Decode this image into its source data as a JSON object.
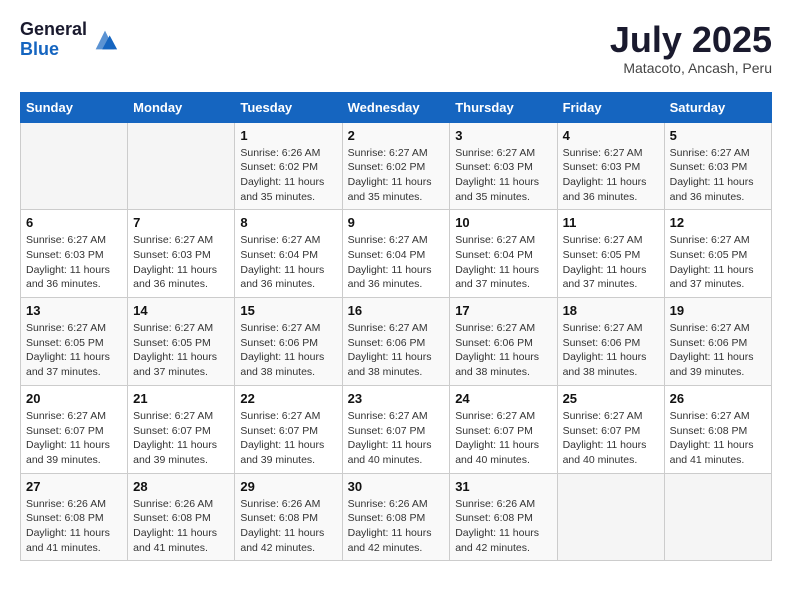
{
  "header": {
    "logo_general": "General",
    "logo_blue": "Blue",
    "month_title": "July 2025",
    "location": "Matacoto, Ancash, Peru"
  },
  "days_of_week": [
    "Sunday",
    "Monday",
    "Tuesday",
    "Wednesday",
    "Thursday",
    "Friday",
    "Saturday"
  ],
  "weeks": [
    [
      {
        "day": "",
        "sunrise": "",
        "sunset": "",
        "daylight": ""
      },
      {
        "day": "",
        "sunrise": "",
        "sunset": "",
        "daylight": ""
      },
      {
        "day": "1",
        "sunrise": "Sunrise: 6:26 AM",
        "sunset": "Sunset: 6:02 PM",
        "daylight": "Daylight: 11 hours and 35 minutes."
      },
      {
        "day": "2",
        "sunrise": "Sunrise: 6:27 AM",
        "sunset": "Sunset: 6:02 PM",
        "daylight": "Daylight: 11 hours and 35 minutes."
      },
      {
        "day": "3",
        "sunrise": "Sunrise: 6:27 AM",
        "sunset": "Sunset: 6:03 PM",
        "daylight": "Daylight: 11 hours and 35 minutes."
      },
      {
        "day": "4",
        "sunrise": "Sunrise: 6:27 AM",
        "sunset": "Sunset: 6:03 PM",
        "daylight": "Daylight: 11 hours and 36 minutes."
      },
      {
        "day": "5",
        "sunrise": "Sunrise: 6:27 AM",
        "sunset": "Sunset: 6:03 PM",
        "daylight": "Daylight: 11 hours and 36 minutes."
      }
    ],
    [
      {
        "day": "6",
        "sunrise": "Sunrise: 6:27 AM",
        "sunset": "Sunset: 6:03 PM",
        "daylight": "Daylight: 11 hours and 36 minutes."
      },
      {
        "day": "7",
        "sunrise": "Sunrise: 6:27 AM",
        "sunset": "Sunset: 6:03 PM",
        "daylight": "Daylight: 11 hours and 36 minutes."
      },
      {
        "day": "8",
        "sunrise": "Sunrise: 6:27 AM",
        "sunset": "Sunset: 6:04 PM",
        "daylight": "Daylight: 11 hours and 36 minutes."
      },
      {
        "day": "9",
        "sunrise": "Sunrise: 6:27 AM",
        "sunset": "Sunset: 6:04 PM",
        "daylight": "Daylight: 11 hours and 36 minutes."
      },
      {
        "day": "10",
        "sunrise": "Sunrise: 6:27 AM",
        "sunset": "Sunset: 6:04 PM",
        "daylight": "Daylight: 11 hours and 37 minutes."
      },
      {
        "day": "11",
        "sunrise": "Sunrise: 6:27 AM",
        "sunset": "Sunset: 6:05 PM",
        "daylight": "Daylight: 11 hours and 37 minutes."
      },
      {
        "day": "12",
        "sunrise": "Sunrise: 6:27 AM",
        "sunset": "Sunset: 6:05 PM",
        "daylight": "Daylight: 11 hours and 37 minutes."
      }
    ],
    [
      {
        "day": "13",
        "sunrise": "Sunrise: 6:27 AM",
        "sunset": "Sunset: 6:05 PM",
        "daylight": "Daylight: 11 hours and 37 minutes."
      },
      {
        "day": "14",
        "sunrise": "Sunrise: 6:27 AM",
        "sunset": "Sunset: 6:05 PM",
        "daylight": "Daylight: 11 hours and 37 minutes."
      },
      {
        "day": "15",
        "sunrise": "Sunrise: 6:27 AM",
        "sunset": "Sunset: 6:06 PM",
        "daylight": "Daylight: 11 hours and 38 minutes."
      },
      {
        "day": "16",
        "sunrise": "Sunrise: 6:27 AM",
        "sunset": "Sunset: 6:06 PM",
        "daylight": "Daylight: 11 hours and 38 minutes."
      },
      {
        "day": "17",
        "sunrise": "Sunrise: 6:27 AM",
        "sunset": "Sunset: 6:06 PM",
        "daylight": "Daylight: 11 hours and 38 minutes."
      },
      {
        "day": "18",
        "sunrise": "Sunrise: 6:27 AM",
        "sunset": "Sunset: 6:06 PM",
        "daylight": "Daylight: 11 hours and 38 minutes."
      },
      {
        "day": "19",
        "sunrise": "Sunrise: 6:27 AM",
        "sunset": "Sunset: 6:06 PM",
        "daylight": "Daylight: 11 hours and 39 minutes."
      }
    ],
    [
      {
        "day": "20",
        "sunrise": "Sunrise: 6:27 AM",
        "sunset": "Sunset: 6:07 PM",
        "daylight": "Daylight: 11 hours and 39 minutes."
      },
      {
        "day": "21",
        "sunrise": "Sunrise: 6:27 AM",
        "sunset": "Sunset: 6:07 PM",
        "daylight": "Daylight: 11 hours and 39 minutes."
      },
      {
        "day": "22",
        "sunrise": "Sunrise: 6:27 AM",
        "sunset": "Sunset: 6:07 PM",
        "daylight": "Daylight: 11 hours and 39 minutes."
      },
      {
        "day": "23",
        "sunrise": "Sunrise: 6:27 AM",
        "sunset": "Sunset: 6:07 PM",
        "daylight": "Daylight: 11 hours and 40 minutes."
      },
      {
        "day": "24",
        "sunrise": "Sunrise: 6:27 AM",
        "sunset": "Sunset: 6:07 PM",
        "daylight": "Daylight: 11 hours and 40 minutes."
      },
      {
        "day": "25",
        "sunrise": "Sunrise: 6:27 AM",
        "sunset": "Sunset: 6:07 PM",
        "daylight": "Daylight: 11 hours and 40 minutes."
      },
      {
        "day": "26",
        "sunrise": "Sunrise: 6:27 AM",
        "sunset": "Sunset: 6:08 PM",
        "daylight": "Daylight: 11 hours and 41 minutes."
      }
    ],
    [
      {
        "day": "27",
        "sunrise": "Sunrise: 6:26 AM",
        "sunset": "Sunset: 6:08 PM",
        "daylight": "Daylight: 11 hours and 41 minutes."
      },
      {
        "day": "28",
        "sunrise": "Sunrise: 6:26 AM",
        "sunset": "Sunset: 6:08 PM",
        "daylight": "Daylight: 11 hours and 41 minutes."
      },
      {
        "day": "29",
        "sunrise": "Sunrise: 6:26 AM",
        "sunset": "Sunset: 6:08 PM",
        "daylight": "Daylight: 11 hours and 42 minutes."
      },
      {
        "day": "30",
        "sunrise": "Sunrise: 6:26 AM",
        "sunset": "Sunset: 6:08 PM",
        "daylight": "Daylight: 11 hours and 42 minutes."
      },
      {
        "day": "31",
        "sunrise": "Sunrise: 6:26 AM",
        "sunset": "Sunset: 6:08 PM",
        "daylight": "Daylight: 11 hours and 42 minutes."
      },
      {
        "day": "",
        "sunrise": "",
        "sunset": "",
        "daylight": ""
      },
      {
        "day": "",
        "sunrise": "",
        "sunset": "",
        "daylight": ""
      }
    ]
  ]
}
